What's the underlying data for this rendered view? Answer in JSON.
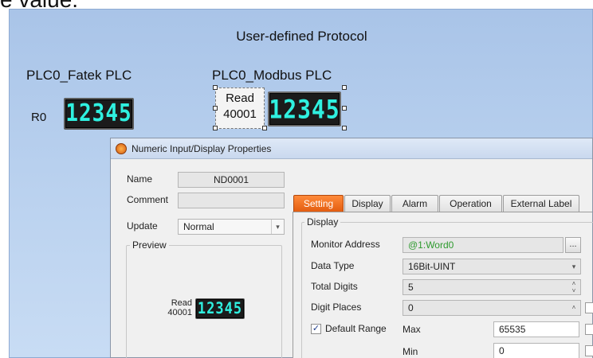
{
  "top_fragment": "e value.",
  "screen": {
    "title": "User-defined Protocol",
    "plc_fatek_label": "PLC0_Fatek PLC",
    "plc_modbus_label": "PLC0_Modbus PLC",
    "r0_label": "R0",
    "fatek_display_value": "12345",
    "modbus_read_line1": "Read",
    "modbus_read_line2": "40001",
    "modbus_display_value": "12345"
  },
  "dialog": {
    "title": "Numeric Input/Display Properties",
    "name_label": "Name",
    "name_value": "ND0001",
    "comment_label": "Comment",
    "comment_value": "",
    "update_label": "Update",
    "update_value": "Normal",
    "preview_title": "Preview",
    "preview_read_line1": "Read",
    "preview_read_line2": "40001",
    "preview_value": "12345",
    "tabs": [
      {
        "label": "Setting",
        "active": true
      },
      {
        "label": "Display",
        "active": false
      },
      {
        "label": "Alarm",
        "active": false
      },
      {
        "label": "Operation",
        "active": false
      },
      {
        "label": "External Label",
        "active": false
      }
    ],
    "display_group_title": "Display",
    "monitor_address_label": "Monitor Address",
    "monitor_address_value": "@1:Word0",
    "monitor_address_color": "#2e9a2e",
    "ellipsis_label": "...",
    "data_type_label": "Data Type",
    "data_type_value": "16Bit-UINT",
    "total_digits_label": "Total Digits",
    "total_digits_value": "5",
    "digit_places_label": "Digit Places",
    "digit_places_value": "0",
    "default_range_label": "Default Range",
    "default_range_checked": true,
    "check_mark": "✓",
    "max_label": "Max",
    "max_value": "65535",
    "min_label": "Min",
    "min_value": "0"
  },
  "colors": {
    "screen_bg": "#b8d0ee",
    "segment_digit": "#2ff0e0",
    "active_tab": "#e35d11"
  }
}
